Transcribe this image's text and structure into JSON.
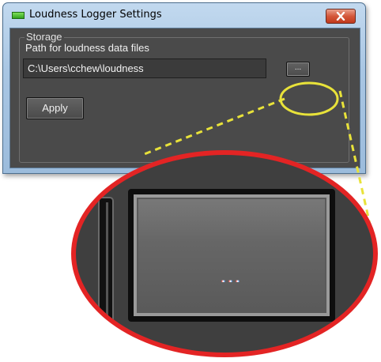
{
  "window": {
    "title": "Loudness Logger Settings",
    "close_label": "close"
  },
  "storage": {
    "group_label": "Storage",
    "path_label": "Path for loudness data files",
    "path_value": "C:\\Users\\cchew\\loudness",
    "browse_label": "...",
    "apply_label": "Apply"
  },
  "annotation": {
    "zoom_label": "...",
    "highlight_color": "#e8e23a",
    "zoom_border_color": "#e32424"
  },
  "icons": {
    "app": "green-led-icon",
    "close": "close-icon"
  }
}
